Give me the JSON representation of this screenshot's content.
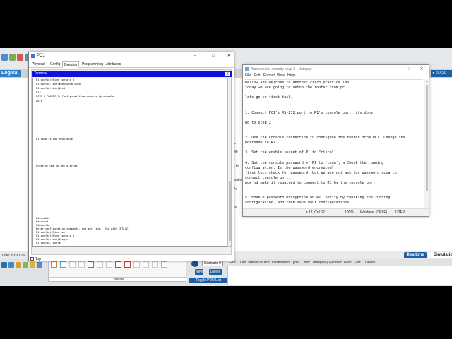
{
  "packet_tracer": {
    "logical_tab": "Logical",
    "time_label": "Time: 00:20:16",
    "realtime_label": "Realtime",
    "simulation_label": "Simulation",
    "scenario_select": "Scenario 0",
    "new_button": "New",
    "delete_button": "Delete",
    "toggle_pdu_button": "Toggle PDU List Window",
    "connections_label": "Console",
    "pdu_columns": [
      "Fire",
      "Last Status",
      "Source",
      "Destination",
      "Type",
      "Color",
      "Time(sec)",
      "Periodic",
      "Num",
      "Edit",
      "Delete"
    ],
    "side_labels": [
      "Ic",
      "ole",
      "s ke",
      "make",
      "Pc",
      "ke"
    ]
  },
  "pc_window": {
    "title": "PC1",
    "tabs": [
      "Physical",
      "Config",
      "Desktop",
      "Programming",
      "Attributes"
    ],
    "active_tab": "Desktop",
    "terminal_title": "Terminal",
    "terminal_close": "X",
    "top_checkbox_label": "Top",
    "terminal_lines_top": [
      "R1(config)#line console 0",
      "R1(config-line)#password ccna",
      "R1(config-line)#end",
      "R1#",
      "%SYS-5-CONFIG_I: Configured from console by console",
      "exit"
    ],
    "terminal_line_con": "R1 con0 is now available",
    "terminal_line_press": "Press RETURN to get started.",
    "terminal_lines_bottom": [
      "R1>enable",
      "Password:",
      "R1#config t",
      "Enter configuration commands, one per line.  End with CNTL/Z.",
      "R1(config)#line con",
      "R1(config)#line console 0",
      "R1(config-line)#login",
      "R1(config-line)#"
    ]
  },
  "notepad": {
    "title": "*basic router security chap 3 - Notepad",
    "menu": [
      "File",
      "Edit",
      "Format",
      "View",
      "Help"
    ],
    "lines": [
      "hellow and welcome to another cisco practice lab,",
      "today we are going to setup the router from pc.",
      "",
      "lets go to first task.",
      "",
      "",
      "1. Connect PC1's RS-232 port to R1's console port. its done.",
      "",
      "go to step 2",
      "",
      "",
      "2. Use the console connection to configure the router from PC1. Change the",
      "hostname to R1.",
      "",
      "3. Set the enable secret of R1 to \"cisco\".",
      "",
      "4. Set the console password of R1 to 'ccna', a Check the running",
      "configuration. Is the password encrypted?",
      "first lets check for password. but we are not ask for password ccna to",
      "connect console port.",
      "now nd make it required to connect to R1 by the console port.",
      "",
      "",
      "5. Enable password encryption on R1. Verify by checking the running",
      "configuration, and then save your configurations."
    ],
    "status": {
      "position": "Ln 17, Col 62",
      "zoom": "100%",
      "line_ending": "Windows (CRLF)",
      "encoding": "UTF-8"
    }
  },
  "colors": {
    "terminal_bar": "#1010e0",
    "pt_blue": "#1b5ea4"
  }
}
